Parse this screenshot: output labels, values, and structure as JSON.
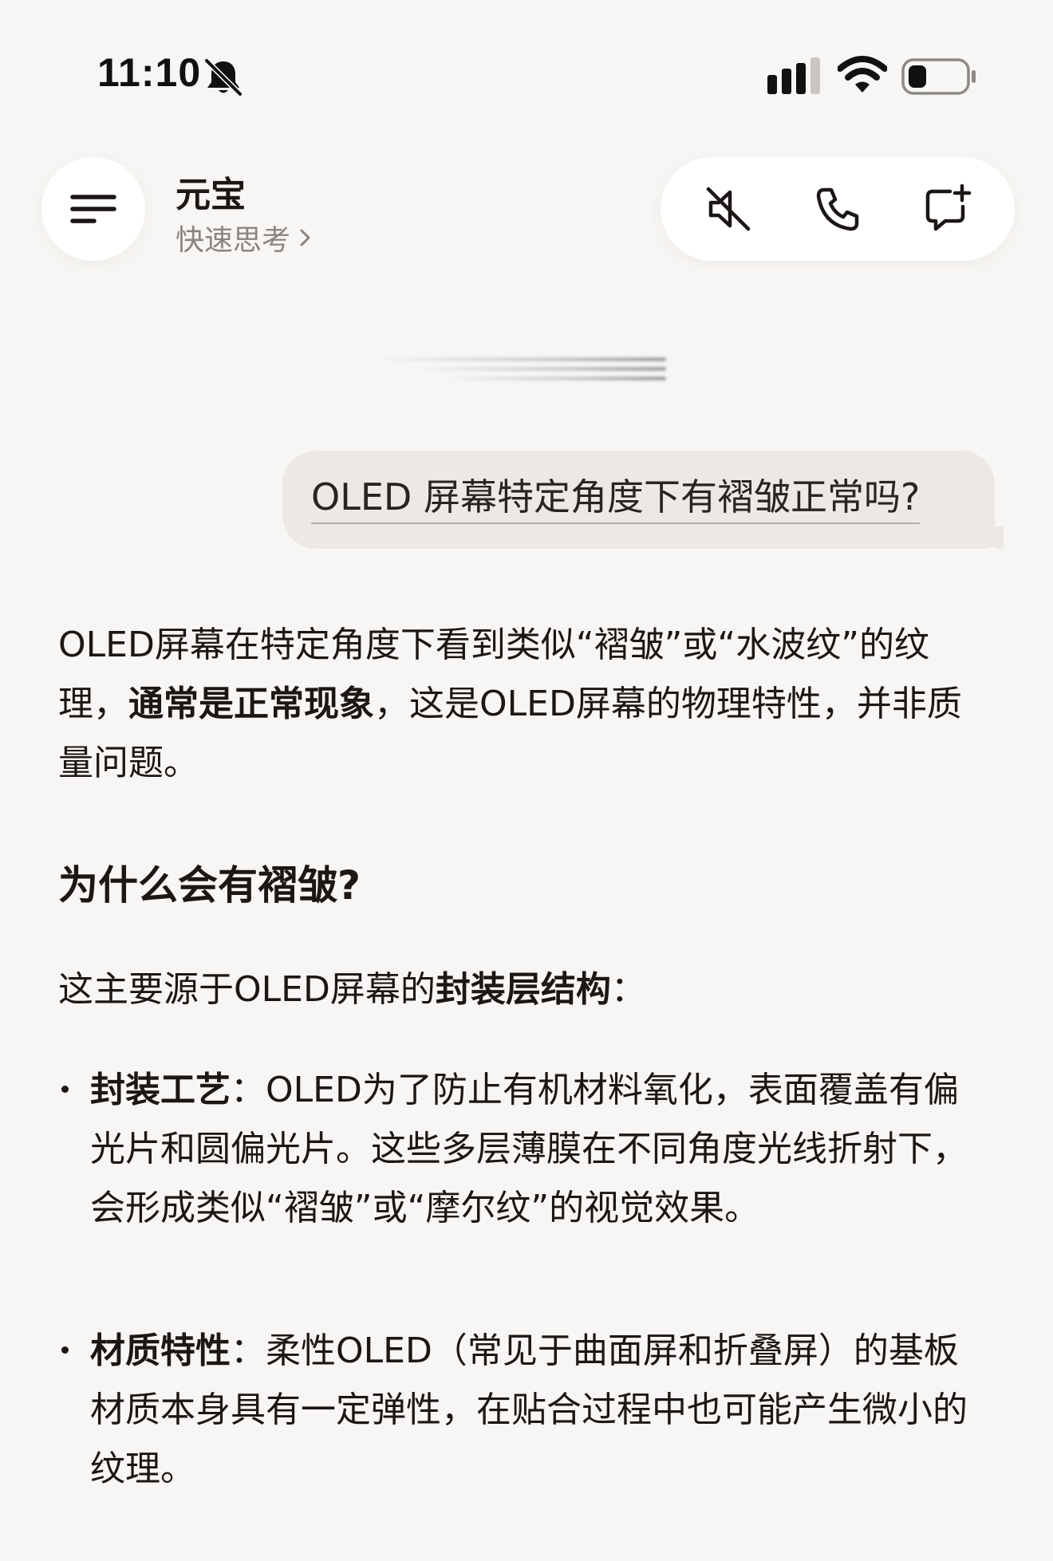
{
  "status_bar": {
    "time": "11:10",
    "icons": [
      "bell-slash-icon",
      "cellular-signal-icon",
      "wifi-icon",
      "battery-icon"
    ]
  },
  "header": {
    "menu_icon": "menu-icon",
    "assistant_name": "元宝",
    "mode_label": "快速思考",
    "mode_chevron_icon": "chevron-right-icon",
    "actions": [
      {
        "icon": "speaker-muted-icon"
      },
      {
        "icon": "phone-icon"
      },
      {
        "icon": "new-chat-icon"
      }
    ]
  },
  "conversation": {
    "user_message": "OLED 屏幕特定角度下有褶皱正常吗?",
    "reply": {
      "intro": {
        "part1": "OLED屏幕在特定角度下看到类似“褶皱”或“水波纹”的纹理，",
        "bold": "通常是正常现象",
        "part2": "，这是OLED屏幕的物理特性，并非质量问题。"
      },
      "heading": "为什么会有褶皱?",
      "cause_intro": {
        "part1": "这主要源于OLED屏幕的",
        "bold": "封装层结构",
        "part2": "："
      },
      "bullets": [
        {
          "title": "封装工艺",
          "separator": "：",
          "text": "OLED为了防止有机材料氧化，表面覆盖有偏光片和圆偏光片。这些多层薄膜在不同角度光线折射下，会形成类似“褶皱”或“摩尔纹”的视觉效果。"
        },
        {
          "title": "材质特性",
          "separator": "：",
          "text": "柔性OLED（常见于曲面屏和折叠屏）的基板材质本身具有一定弹性，在贴合过程中也可能产生微小的纹理。"
        }
      ]
    }
  },
  "colors": {
    "background": "#f8f6f4",
    "surface": "#ffffff",
    "user_bubble": "#ece9e5",
    "text": "#1c1714",
    "secondary_text": "#8b847e"
  }
}
